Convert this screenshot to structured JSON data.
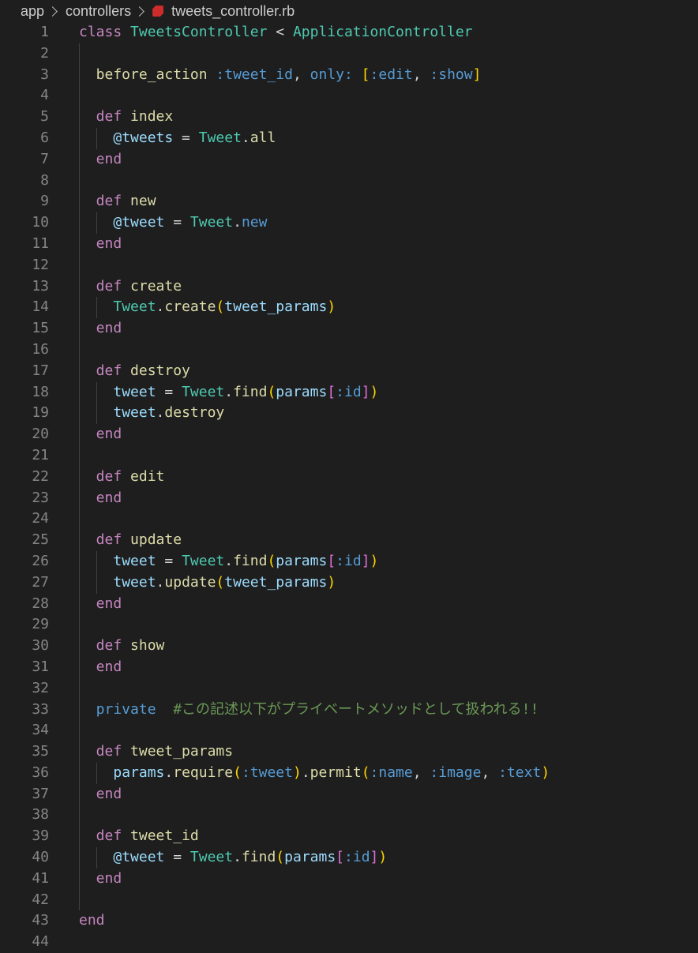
{
  "breadcrumb": {
    "items": [
      "app",
      "controllers",
      "tweets_controller.rb"
    ]
  },
  "editor": {
    "language": "ruby",
    "lines": [
      {
        "n": "1",
        "indent": 0,
        "tokens": [
          [
            "kw",
            "class "
          ],
          [
            "cls",
            "TweetsController"
          ],
          [
            "op",
            " < "
          ],
          [
            "cls",
            "ApplicationController"
          ]
        ]
      },
      {
        "n": "2",
        "indent": 0,
        "tokens": []
      },
      {
        "n": "3",
        "indent": 1,
        "tokens": [
          [
            "fn",
            "before_action"
          ],
          [
            "op",
            " "
          ],
          [
            "sym",
            ":tweet_id"
          ],
          [
            "op",
            ", "
          ],
          [
            "sym",
            "only:"
          ],
          [
            "op",
            " "
          ],
          [
            "br1",
            "["
          ],
          [
            "sym",
            ":edit"
          ],
          [
            "op",
            ", "
          ],
          [
            "sym",
            ":show"
          ],
          [
            "br1",
            "]"
          ]
        ]
      },
      {
        "n": "4",
        "indent": 0,
        "tokens": []
      },
      {
        "n": "5",
        "indent": 1,
        "tokens": [
          [
            "kw",
            "def"
          ],
          [
            "op",
            " "
          ],
          [
            "fn",
            "index"
          ]
        ]
      },
      {
        "n": "6",
        "indent": 2,
        "tokens": [
          [
            "var",
            "@tweets"
          ],
          [
            "op",
            " = "
          ],
          [
            "cls",
            "Tweet"
          ],
          [
            "op",
            "."
          ],
          [
            "fn",
            "all"
          ]
        ]
      },
      {
        "n": "7",
        "indent": 1,
        "tokens": [
          [
            "kw",
            "end"
          ]
        ]
      },
      {
        "n": "8",
        "indent": 0,
        "tokens": []
      },
      {
        "n": "9",
        "indent": 1,
        "tokens": [
          [
            "kw",
            "def"
          ],
          [
            "op",
            " "
          ],
          [
            "fn",
            "new"
          ]
        ]
      },
      {
        "n": "10",
        "indent": 2,
        "tokens": [
          [
            "var",
            "@tweet"
          ],
          [
            "op",
            " = "
          ],
          [
            "cls",
            "Tweet"
          ],
          [
            "op",
            "."
          ],
          [
            "sym",
            "new"
          ]
        ]
      },
      {
        "n": "11",
        "indent": 1,
        "tokens": [
          [
            "kw",
            "end"
          ]
        ]
      },
      {
        "n": "12",
        "indent": 0,
        "tokens": []
      },
      {
        "n": "13",
        "indent": 1,
        "tokens": [
          [
            "kw",
            "def"
          ],
          [
            "op",
            " "
          ],
          [
            "fn",
            "create"
          ]
        ]
      },
      {
        "n": "14",
        "indent": 2,
        "tokens": [
          [
            "cls",
            "Tweet"
          ],
          [
            "op",
            "."
          ],
          [
            "fn",
            "create"
          ],
          [
            "br1",
            "("
          ],
          [
            "var",
            "tweet_params"
          ],
          [
            "br1",
            ")"
          ]
        ]
      },
      {
        "n": "15",
        "indent": 1,
        "tokens": [
          [
            "kw",
            "end"
          ]
        ]
      },
      {
        "n": "16",
        "indent": 0,
        "tokens": []
      },
      {
        "n": "17",
        "indent": 1,
        "tokens": [
          [
            "kw",
            "def"
          ],
          [
            "op",
            " "
          ],
          [
            "fn",
            "destroy"
          ]
        ]
      },
      {
        "n": "18",
        "indent": 2,
        "tokens": [
          [
            "var",
            "tweet"
          ],
          [
            "op",
            " = "
          ],
          [
            "cls",
            "Tweet"
          ],
          [
            "op",
            "."
          ],
          [
            "fn",
            "find"
          ],
          [
            "br1",
            "("
          ],
          [
            "var",
            "params"
          ],
          [
            "br2",
            "["
          ],
          [
            "sym",
            ":id"
          ],
          [
            "br2",
            "]"
          ],
          [
            "br1",
            ")"
          ]
        ]
      },
      {
        "n": "19",
        "indent": 2,
        "tokens": [
          [
            "var",
            "tweet"
          ],
          [
            "op",
            "."
          ],
          [
            "fn",
            "destroy"
          ]
        ]
      },
      {
        "n": "20",
        "indent": 1,
        "tokens": [
          [
            "kw",
            "end"
          ]
        ]
      },
      {
        "n": "21",
        "indent": 0,
        "tokens": []
      },
      {
        "n": "22",
        "indent": 1,
        "tokens": [
          [
            "kw",
            "def"
          ],
          [
            "op",
            " "
          ],
          [
            "fn",
            "edit"
          ]
        ]
      },
      {
        "n": "23",
        "indent": 1,
        "tokens": [
          [
            "kw",
            "end"
          ]
        ]
      },
      {
        "n": "24",
        "indent": 0,
        "tokens": []
      },
      {
        "n": "25",
        "indent": 1,
        "tokens": [
          [
            "kw",
            "def"
          ],
          [
            "op",
            " "
          ],
          [
            "fn",
            "update"
          ]
        ]
      },
      {
        "n": "26",
        "indent": 2,
        "tokens": [
          [
            "var",
            "tweet"
          ],
          [
            "op",
            " = "
          ],
          [
            "cls",
            "Tweet"
          ],
          [
            "op",
            "."
          ],
          [
            "fn",
            "find"
          ],
          [
            "br1",
            "("
          ],
          [
            "var",
            "params"
          ],
          [
            "br2",
            "["
          ],
          [
            "sym",
            ":id"
          ],
          [
            "br2",
            "]"
          ],
          [
            "br1",
            ")"
          ]
        ]
      },
      {
        "n": "27",
        "indent": 2,
        "tokens": [
          [
            "var",
            "tweet"
          ],
          [
            "op",
            "."
          ],
          [
            "fn",
            "update"
          ],
          [
            "br1",
            "("
          ],
          [
            "var",
            "tweet_params"
          ],
          [
            "br1",
            ")"
          ]
        ]
      },
      {
        "n": "28",
        "indent": 1,
        "tokens": [
          [
            "kw",
            "end"
          ]
        ]
      },
      {
        "n": "29",
        "indent": 0,
        "tokens": []
      },
      {
        "n": "30",
        "indent": 1,
        "tokens": [
          [
            "kw",
            "def"
          ],
          [
            "op",
            " "
          ],
          [
            "fn",
            "show"
          ]
        ]
      },
      {
        "n": "31",
        "indent": 1,
        "tokens": [
          [
            "kw",
            "end"
          ]
        ]
      },
      {
        "n": "32",
        "indent": 0,
        "tokens": []
      },
      {
        "n": "33",
        "indent": 1,
        "tokens": [
          [
            "priv",
            "private"
          ],
          [
            "op",
            "  "
          ],
          [
            "cmt",
            "#この記述以下がプライベートメソッドとして扱われる!!"
          ]
        ]
      },
      {
        "n": "34",
        "indent": 0,
        "tokens": []
      },
      {
        "n": "35",
        "indent": 1,
        "tokens": [
          [
            "kw",
            "def"
          ],
          [
            "op",
            " "
          ],
          [
            "fn",
            "tweet_params"
          ]
        ]
      },
      {
        "n": "36",
        "indent": 2,
        "tokens": [
          [
            "var",
            "params"
          ],
          [
            "op",
            "."
          ],
          [
            "fn",
            "require"
          ],
          [
            "br1",
            "("
          ],
          [
            "sym",
            ":tweet"
          ],
          [
            "br1",
            ")"
          ],
          [
            "op",
            "."
          ],
          [
            "fn",
            "permit"
          ],
          [
            "br1",
            "("
          ],
          [
            "sym",
            ":name"
          ],
          [
            "op",
            ", "
          ],
          [
            "sym",
            ":image"
          ],
          [
            "op",
            ", "
          ],
          [
            "sym",
            ":text"
          ],
          [
            "br1",
            ")"
          ]
        ]
      },
      {
        "n": "37",
        "indent": 1,
        "tokens": [
          [
            "kw",
            "end"
          ]
        ]
      },
      {
        "n": "38",
        "indent": 0,
        "tokens": []
      },
      {
        "n": "39",
        "indent": 1,
        "tokens": [
          [
            "kw",
            "def"
          ],
          [
            "op",
            " "
          ],
          [
            "fn",
            "tweet_id"
          ]
        ]
      },
      {
        "n": "40",
        "indent": 2,
        "tokens": [
          [
            "var",
            "@tweet"
          ],
          [
            "op",
            " = "
          ],
          [
            "cls",
            "Tweet"
          ],
          [
            "op",
            "."
          ],
          [
            "fn",
            "find"
          ],
          [
            "br1",
            "("
          ],
          [
            "var",
            "params"
          ],
          [
            "br2",
            "["
          ],
          [
            "sym",
            ":id"
          ],
          [
            "br2",
            "]"
          ],
          [
            "br1",
            ")"
          ]
        ]
      },
      {
        "n": "41",
        "indent": 1,
        "tokens": [
          [
            "kw",
            "end"
          ]
        ]
      },
      {
        "n": "42",
        "indent": 0,
        "tokens": []
      },
      {
        "n": "43",
        "indent": 0,
        "tokens": [
          [
            "kw",
            "end"
          ]
        ]
      },
      {
        "n": "44",
        "indent": 0,
        "tokens": []
      }
    ]
  },
  "colors": {
    "background": "#1e1e1e",
    "keyword": "#c586c0",
    "class": "#4ec9b0",
    "function": "#dcdcaa",
    "variable": "#9cdcfe",
    "symbol": "#569cd6",
    "comment": "#6a9955",
    "bracket1": "#ffd700",
    "bracket2": "#da70d6"
  }
}
